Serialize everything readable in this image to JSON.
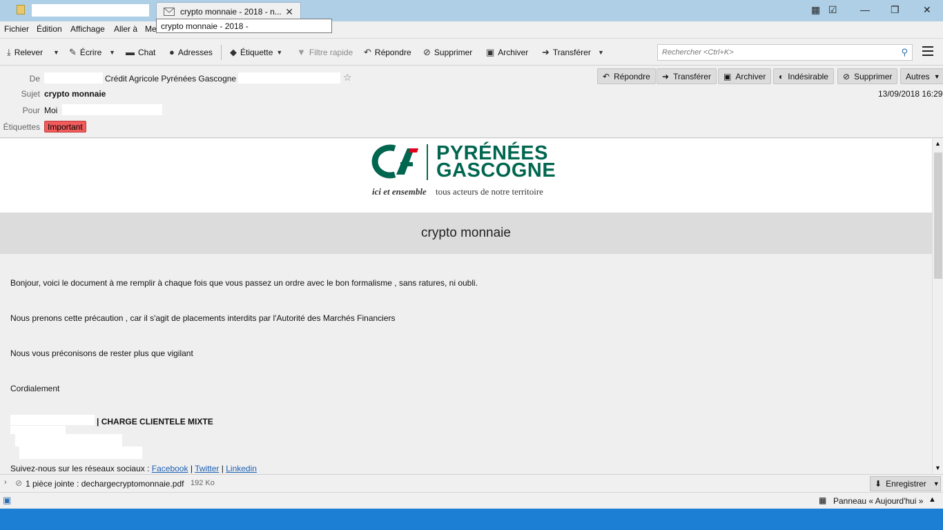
{
  "window": {
    "tab_title": "crypto monnaie - 2018 - n...",
    "tooltip": "crypto monnaie - 2018 -"
  },
  "menu": {
    "file": "Fichier",
    "edit": "Édition",
    "view": "Affichage",
    "go": "Aller à",
    "message": "Me"
  },
  "toolbar": {
    "get": "Relever",
    "write": "Écrire",
    "chat": "Chat",
    "addresses": "Adresses",
    "tag": "Étiquette",
    "filter": "Filtre rapide",
    "reply": "Répondre",
    "delete": "Supprimer",
    "archive": "Archiver",
    "forward": "Transférer",
    "search_placeholder": "Rechercher <Ctrl+K>"
  },
  "header": {
    "from_label": "De",
    "from_value": "Crédit Agricole Pyrénées Gascogne <",
    "subject_label": "Sujet",
    "subject_value": "crypto monnaie",
    "to_label": "Pour",
    "to_value": "Moi",
    "tags_label": "Étiquettes",
    "tag_important": "Important",
    "date": "13/09/2018 16:29",
    "btn_reply": "Répondre",
    "btn_forward": "Transférer",
    "btn_archive": "Archiver",
    "btn_junk": "Indésirable",
    "btn_delete": "Supprimer",
    "btn_other": "Autres"
  },
  "logo": {
    "line1": "PYRÉNÉES",
    "line2": "GASCOGNE",
    "tagline_italic": "ici et ensemble",
    "tagline_rest": "tous acteurs de notre territoire"
  },
  "message": {
    "band_title": "crypto monnaie",
    "p1": "Bonjour, voici le document à me remplir à chaque fois que vous passez un ordre avec le bon formalisme , sans ratures, ni oubli.",
    "p2": "Nous prenons cette précaution , car il s'agit de placements interdits par l'Autorité des Marchés Financiers",
    "p3": "Nous vous préconisons de rester plus que vigilant",
    "p4": "Cordialement",
    "signature_title": "| CHARGE CLIENTELE MIXTE",
    "social_prefix": "Suivez-nous sur les réseaux sociaux :",
    "facebook": "Facebook",
    "twitter": "Twitter",
    "linkedin": "Linkedin"
  },
  "attachment": {
    "summary": "1 pièce jointe : dechargecryptomonnaie.pdf",
    "size": "192 Ko",
    "save": "Enregistrer"
  },
  "statusbar": {
    "today_pane": "Panneau « Aujourd'hui »"
  },
  "colors": {
    "brand_green": "#00664f",
    "brand_red": "#e2001a",
    "tag_important": "#f15b5b"
  }
}
